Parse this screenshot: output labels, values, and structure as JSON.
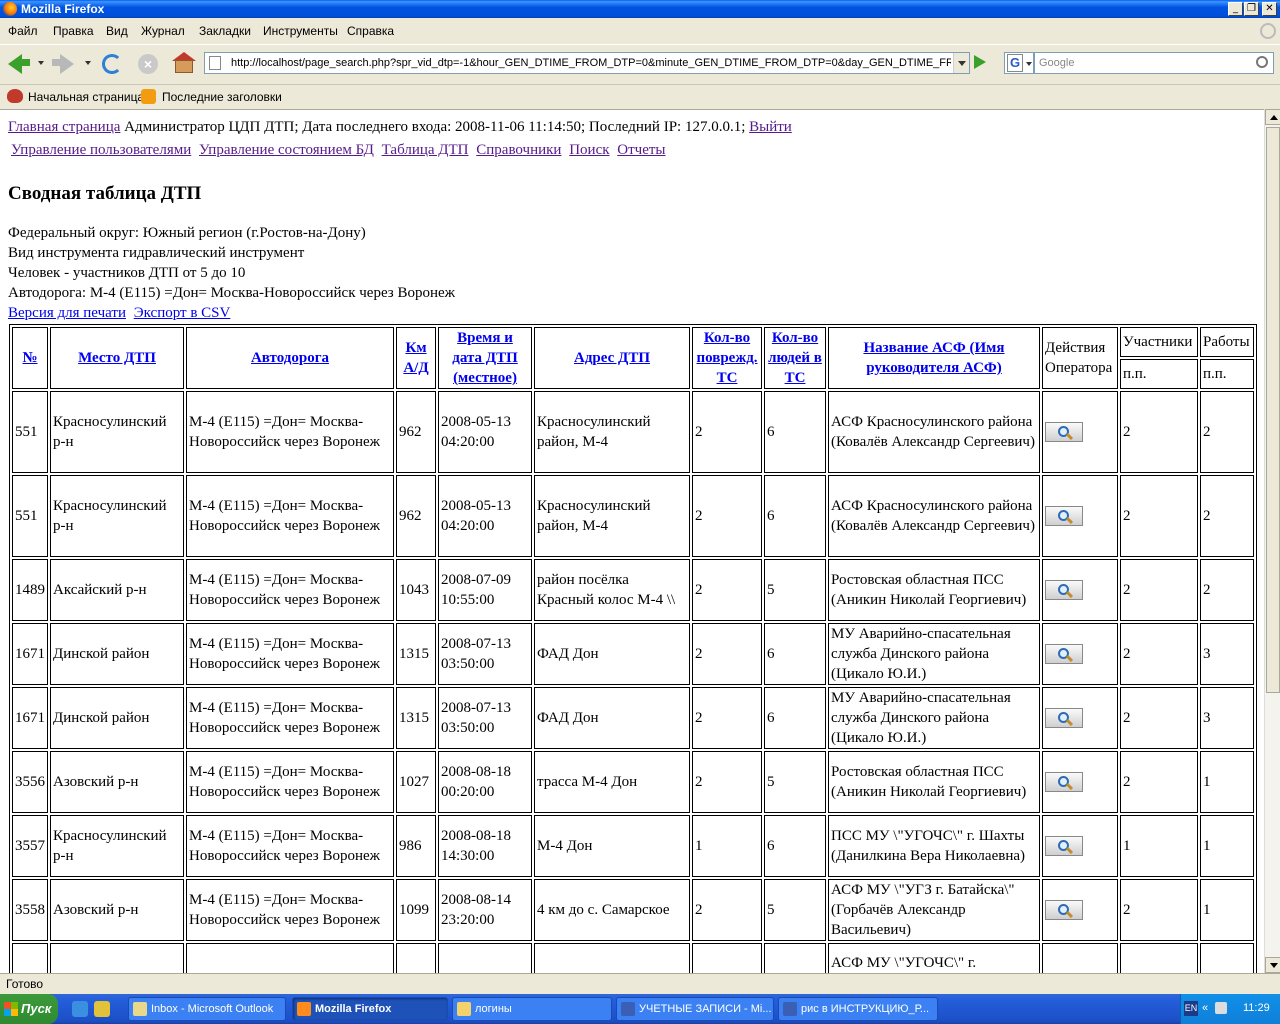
{
  "window": {
    "title": "Mozilla Firefox",
    "minimize": "_",
    "maximize": "❐",
    "close": "✕"
  },
  "menu": [
    "Файл",
    "Правка",
    "Вид",
    "Журнал",
    "Закладки",
    "Инструменты",
    "Справка"
  ],
  "nav": {
    "url": "http://localhost/page_search.php?spr_vid_dtp=-1&hour_GEN_DTIME_FROM_DTP=0&minute_GEN_DTIME_FROM_DTP=0&day_GEN_DTIME_FROM",
    "search_placeholder": "Google",
    "search_engine": "G"
  },
  "bookmarks": [
    "Начальная страница",
    "Последние заголовки"
  ],
  "page": {
    "home_link": "Главная страница",
    "user_info": " Администратор ЦДП ДТП; Дата последнего входа: 2008-11-06 11:14:50; Последний IP: 127.0.0.1; ",
    "logout": "Выйти",
    "admin_links": [
      "Управление пользователями",
      "Управление состоянием БД",
      "Таблица ДТП",
      "Справочники",
      "Поиск",
      "Отчеты"
    ],
    "title": "Сводная таблица ДТП",
    "filters": [
      "Федеральный округ: Южный регион (г.Ростов-на-Дону)",
      "Вид инструмента гидравлический инструмент",
      "Человек - участников ДТП от 5 до 10",
      "Автодорога: М-4 (Е115) =Дон= Москва-Новороссийск через Воронеж"
    ],
    "print_link": "Версия для печати",
    "csv_link": "Экспорт в CSV"
  },
  "table": {
    "headers": {
      "num": "№",
      "place": "Место ДТП",
      "road": "Автодорога",
      "km": "Км А/Д",
      "time": "Время и дата ДТП (местное)",
      "address": "Адрес ДТП",
      "damaged": "Кол-во поврежд. ТС",
      "people": "Кол-во людей в ТС",
      "asf": "Название АСФ (Имя руководителя АСФ)",
      "actions": "Действия Оператора",
      "participants": "Участники",
      "works": "Работы",
      "pp1": "п.п.",
      "pp2": "п.п."
    },
    "rows": [
      {
        "num": "551",
        "place": "Красносулинский р-н",
        "road": "М-4 (Е115) =Дон= Москва-Новороссийск через Воронеж",
        "km": "962",
        "time": "2008-05-13 04:20:00",
        "address": "Красносулинский район, М-4",
        "damaged": "2",
        "people": "6",
        "asf": "АСФ Красносулинского района (Ковалёв Александр Сергеевич)",
        "participants": "2",
        "works": "2"
      },
      {
        "num": "551",
        "place": "Красносулинский р-н",
        "road": "М-4 (Е115) =Дон= Москва-Новороссийск через Воронеж",
        "km": "962",
        "time": "2008-05-13 04:20:00",
        "address": "Красносулинский район, М-4",
        "damaged": "2",
        "people": "6",
        "asf": "АСФ Красносулинского района (Ковалёв Александр Сергеевич)",
        "participants": "2",
        "works": "2"
      },
      {
        "num": "1489",
        "place": "Аксайский р-н",
        "road": "М-4 (Е115) =Дон= Москва-Новороссийск через Воронеж",
        "km": "1043",
        "time": "2008-07-09 10:55:00",
        "address": "район посёлка Красный колос М-4 \\\\",
        "damaged": "2",
        "people": "5",
        "asf": "Ростовская областная ПСС (Аникин Николай Георгиевич)",
        "participants": "2",
        "works": "2"
      },
      {
        "num": "1671",
        "place": "Динской район",
        "road": "М-4 (Е115) =Дон= Москва-Новороссийск через Воронеж",
        "km": "1315",
        "time": "2008-07-13 03:50:00",
        "address": "ФАД Дон",
        "damaged": "2",
        "people": "6",
        "asf": "МУ Аварийно-спасательная служба Динского района (Цикало Ю.И.)",
        "participants": "2",
        "works": "3"
      },
      {
        "num": "1671",
        "place": "Динской район",
        "road": "М-4 (Е115) =Дон= Москва-Новороссийск через Воронеж",
        "km": "1315",
        "time": "2008-07-13 03:50:00",
        "address": "ФАД Дон",
        "damaged": "2",
        "people": "6",
        "asf": "МУ Аварийно-спасательная служба Динского района (Цикало Ю.И.)",
        "participants": "2",
        "works": "3"
      },
      {
        "num": "3556",
        "place": "Азовский р-н",
        "road": "М-4 (Е115) =Дон= Москва-Новороссийск через Воронеж",
        "km": "1027",
        "time": "2008-08-18 00:20:00",
        "address": "трасса М-4 Дон",
        "damaged": "2",
        "people": "5",
        "asf": "Ростовская областная ПСС (Аникин Николай Георгиевич)",
        "participants": "2",
        "works": "1"
      },
      {
        "num": "3557",
        "place": "Красносулинский р-н",
        "road": "М-4 (Е115) =Дон= Москва-Новороссийск через Воронеж",
        "km": "986",
        "time": "2008-08-18 14:30:00",
        "address": "М-4 Дон",
        "damaged": "1",
        "people": "6",
        "asf": "ПСС МУ \\\"УГОЧС\\\" г. Шахты (Данилкина Вера Николаевна)",
        "participants": "1",
        "works": "1"
      },
      {
        "num": "3558",
        "place": "Азовский р-н",
        "road": "М-4 (Е115) =Дон= Москва-Новороссийск через Воронеж",
        "km": "1099",
        "time": "2008-08-14 23:20:00",
        "address": "4 км до с. Самарское",
        "damaged": "2",
        "people": "5",
        "asf": "АСФ МУ \\\"УГЗ г. Батайска\\\" (Горбачёв Александр Васильевич)",
        "participants": "2",
        "works": "1"
      },
      {
        "num": "",
        "place": "",
        "road": "",
        "km": "",
        "time": "",
        "address": "",
        "damaged": "",
        "people": "",
        "asf": "АСФ МУ \\\"УГОЧС\\\" г.",
        "participants": "",
        "works": ""
      }
    ]
  },
  "status": "Готово",
  "taskbar": {
    "start": "Пуск",
    "tasks": [
      "Inbox - Microsoft Outlook",
      "Mozilla Firefox",
      "логины",
      "УЧЕТНЫЕ ЗАПИСИ - Mi...",
      "рис в ИНСТРУКЦИЮ_Р..."
    ],
    "lang": "EN",
    "tray_arrows": "«",
    "clock": "11:29"
  }
}
